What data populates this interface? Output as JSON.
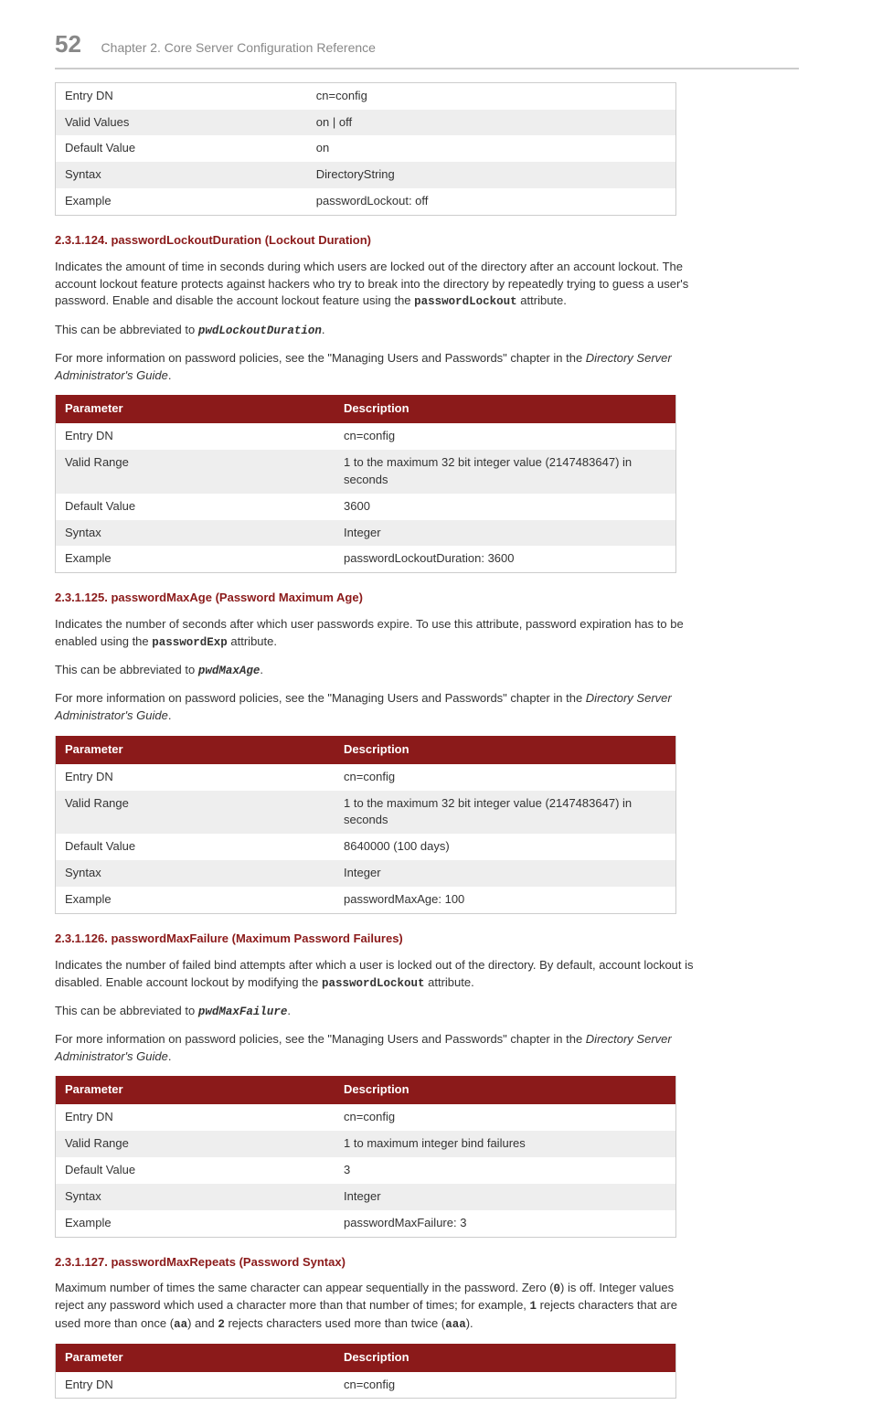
{
  "header": {
    "page_number": "52",
    "chapter_title": "Chapter 2. Core Server Configuration Reference"
  },
  "table0": {
    "rows": [
      {
        "p": "Entry DN",
        "d": "cn=config"
      },
      {
        "p": "Valid Values",
        "d": "on | off"
      },
      {
        "p": "Default Value",
        "d": "on"
      },
      {
        "p": "Syntax",
        "d": "DirectoryString"
      },
      {
        "p": "Example",
        "d": "passwordLockout: off"
      }
    ]
  },
  "section124": {
    "heading": "2.3.1.124. passwordLockoutDuration (Lockout Duration)",
    "p1_a": "Indicates the amount of time in seconds during which users are locked out of the directory after an account lockout. The account lockout feature protects against hackers who try to break into the directory by repeatedly trying to guess a user's password. Enable and disable the account lockout feature using the ",
    "p1_code": "passwordLockout",
    "p1_b": " attribute.",
    "p2_a": "This can be abbreviated to ",
    "p2_code": "pwdLockoutDuration",
    "p2_b": ".",
    "p3_a": "For more information on password policies, see the \"Managing Users and Passwords\" chapter in the ",
    "p3_i": "Directory Server Administrator's Guide",
    "p3_b": ".",
    "th_p": "Parameter",
    "th_d": "Description",
    "rows": [
      {
        "p": "Entry DN",
        "d": "cn=config"
      },
      {
        "p": "Valid Range",
        "d": "1 to the maximum 32 bit integer value (2147483647) in seconds"
      },
      {
        "p": "Default Value",
        "d": "3600"
      },
      {
        "p": "Syntax",
        "d": "Integer"
      },
      {
        "p": "Example",
        "d": "passwordLockoutDuration: 3600"
      }
    ]
  },
  "section125": {
    "heading": "2.3.1.125. passwordMaxAge (Password Maximum Age)",
    "p1_a": "Indicates the number of seconds after which user passwords expire. To use this attribute, password expiration has to be enabled using the ",
    "p1_code": "passwordExp",
    "p1_b": " attribute.",
    "p2_a": "This can be abbreviated to ",
    "p2_code": "pwdMaxAge",
    "p2_b": ".",
    "p3_a": "For more information on password policies, see the \"Managing Users and Passwords\" chapter in the ",
    "p3_i": "Directory Server Administrator's Guide",
    "p3_b": ".",
    "th_p": "Parameter",
    "th_d": "Description",
    "rows": [
      {
        "p": "Entry DN",
        "d": "cn=config"
      },
      {
        "p": "Valid Range",
        "d": "1 to the maximum 32 bit integer value (2147483647) in seconds"
      },
      {
        "p": "Default Value",
        "d": "8640000 (100 days)"
      },
      {
        "p": "Syntax",
        "d": "Integer"
      },
      {
        "p": "Example",
        "d": "passwordMaxAge: 100"
      }
    ]
  },
  "section126": {
    "heading": "2.3.1.126. passwordMaxFailure (Maximum Password Failures)",
    "p1_a": "Indicates the number of failed bind attempts after which a user is locked out of the directory. By default, account lockout is disabled. Enable account lockout by modifying the ",
    "p1_code": "passwordLockout",
    "p1_b": " attribute.",
    "p2_a": "This can be abbreviated to ",
    "p2_code": "pwdMaxFailure",
    "p2_b": ".",
    "p3_a": "For more information on password policies, see the \"Managing Users and Passwords\" chapter in the ",
    "p3_i": "Directory Server Administrator's Guide",
    "p3_b": ".",
    "th_p": "Parameter",
    "th_d": "Description",
    "rows": [
      {
        "p": "Entry DN",
        "d": "cn=config"
      },
      {
        "p": "Valid Range",
        "d": "1 to maximum integer bind failures"
      },
      {
        "p": "Default Value",
        "d": "3"
      },
      {
        "p": "Syntax",
        "d": "Integer"
      },
      {
        "p": "Example",
        "d": "passwordMaxFailure: 3"
      }
    ]
  },
  "section127": {
    "heading": "2.3.1.127. passwordMaxRepeats (Password Syntax)",
    "p1_a": "Maximum number of times the same character can appear sequentially in the password. Zero (",
    "p1_c1": "0",
    "p1_b": ") is off. Integer values reject any password which used a character more than that number of times; for example, ",
    "p1_c2": "1",
    "p1_c": " rejects characters that are used more than once (",
    "p1_c3": "aa",
    "p1_d": ") and ",
    "p1_c4": "2",
    "p1_e": " rejects characters used more than twice (",
    "p1_c5": "aaa",
    "p1_f": ").",
    "th_p": "Parameter",
    "th_d": "Description",
    "rows": [
      {
        "p": "Entry DN",
        "d": "cn=config"
      }
    ]
  }
}
